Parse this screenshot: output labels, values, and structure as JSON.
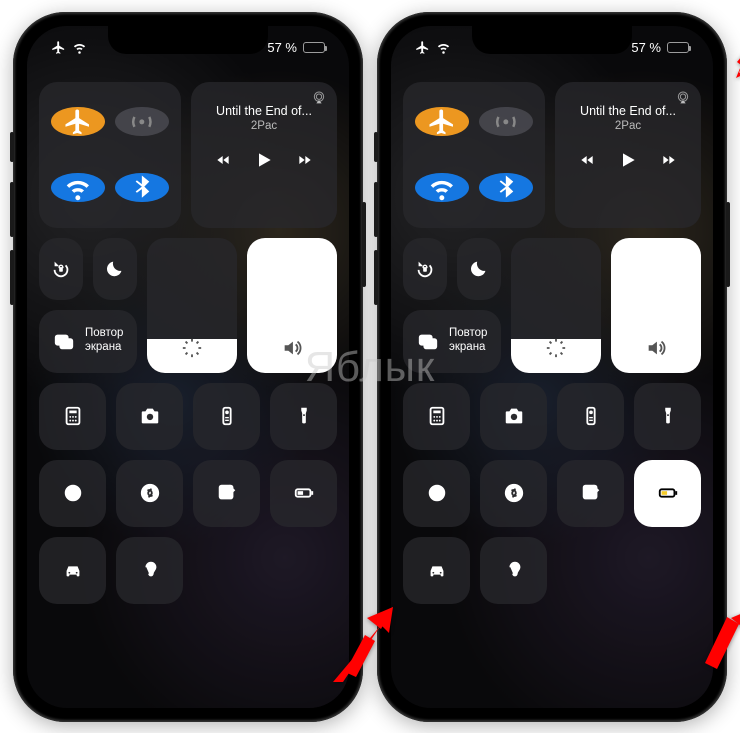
{
  "watermark": "Яблык",
  "phones": [
    {
      "status": {
        "battery_text": "57 %",
        "battery_fill_pct": 57,
        "battery_color": "white"
      },
      "media": {
        "title": "Until the End of...",
        "artist": "2Pac"
      },
      "mirror": {
        "label_line1": "Повтор",
        "label_line2": "экрана"
      },
      "brightness_pct": 25,
      "volume_pct": 100,
      "low_power_active": false
    },
    {
      "status": {
        "battery_text": "57 %",
        "battery_fill_pct": 57,
        "battery_color": "yellow"
      },
      "media": {
        "title": "Until the End of...",
        "artist": "2Pac"
      },
      "mirror": {
        "label_line1": "Повтор",
        "label_line2": "экрана"
      },
      "brightness_pct": 25,
      "volume_pct": 100,
      "low_power_active": true
    }
  ]
}
